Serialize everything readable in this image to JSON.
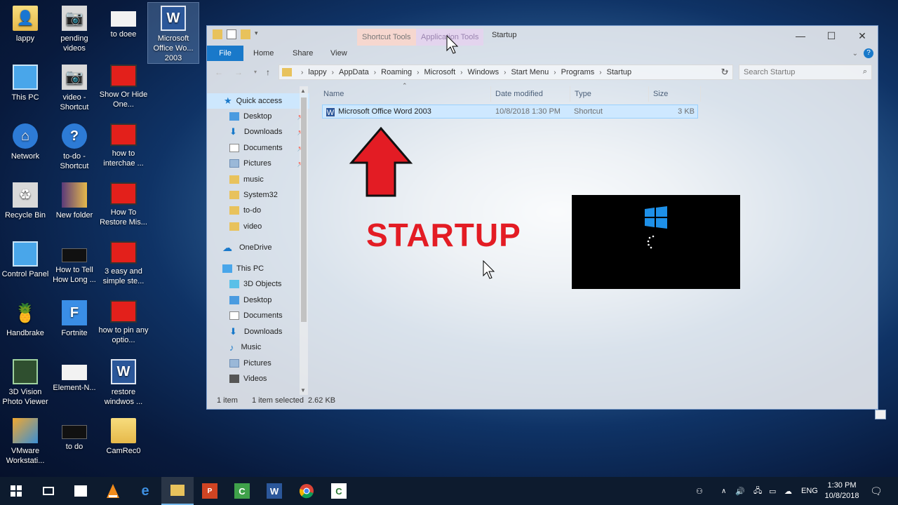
{
  "desktop": {
    "icons": [
      {
        "label": "lappy",
        "icon": "user-folder-icon"
      },
      {
        "label": "pending videos",
        "icon": "camera-icon"
      },
      {
        "label": "to doee",
        "icon": "white-file-icon"
      },
      {
        "label": "Microsoft Office Wo... 2003",
        "icon": "word-icon"
      },
      {
        "label": "This PC",
        "icon": "pc-icon"
      },
      {
        "label": "video - Shortcut",
        "icon": "camera-icon"
      },
      {
        "label": "Show Or Hide One...",
        "icon": "video-thumbnail-icon"
      },
      {
        "label": "Network",
        "icon": "network-icon"
      },
      {
        "label": "to-do - Shortcut",
        "icon": "help-icon"
      },
      {
        "label": "how to interchae ...",
        "icon": "video-thumbnail-icon"
      },
      {
        "label": "Recycle Bin",
        "icon": "recycle-bin-icon"
      },
      {
        "label": "New folder",
        "icon": "folder-icon"
      },
      {
        "label": "How To Restore Mis...",
        "icon": "video-thumbnail-icon"
      },
      {
        "label": "Control Panel",
        "icon": "control-panel-icon"
      },
      {
        "label": "How to Tell How Long ...",
        "icon": "video-thumbnail-icon"
      },
      {
        "label": "3 easy and simple ste...",
        "icon": "video-thumbnail-icon"
      },
      {
        "label": "Handbrake",
        "icon": "handbrake-icon"
      },
      {
        "label": "Fortnite",
        "icon": "fortnite-icon"
      },
      {
        "label": "how to pin any optio...",
        "icon": "video-thumbnail-icon"
      },
      {
        "label": "3D Vision Photo Viewer",
        "icon": "3d-vision-icon"
      },
      {
        "label": "Element-N...",
        "icon": "white-file-icon"
      },
      {
        "label": "restore windwos ...",
        "icon": "word-icon"
      },
      {
        "label": "VMware Workstati...",
        "icon": "vmware-icon"
      },
      {
        "label": "to do",
        "icon": "black-file-icon"
      },
      {
        "label": "CamRec0",
        "icon": "folder-icon"
      }
    ]
  },
  "window": {
    "ctx_shortcut": "Shortcut Tools",
    "ctx_app": "Application Tools",
    "title": "Startup",
    "minimize": "—",
    "maximize": "☐",
    "close": "✕",
    "tabs": {
      "file": "File",
      "home": "Home",
      "share": "Share",
      "view": "View"
    },
    "address": [
      "lappy",
      "AppData",
      "Roaming",
      "Microsoft",
      "Windows",
      "Start Menu",
      "Programs",
      "Startup"
    ],
    "search_placeholder": "Search Startup",
    "nav": {
      "quick_access": "Quick access",
      "qa_items": [
        "Desktop",
        "Downloads",
        "Documents",
        "Pictures",
        "music",
        "System32",
        "to-do",
        "video"
      ],
      "onedrive": "OneDrive",
      "this_pc": "This PC",
      "pc_items": [
        "3D Objects",
        "Desktop",
        "Documents",
        "Downloads",
        "Music",
        "Pictures",
        "Videos"
      ]
    },
    "columns": {
      "name": "Name",
      "date": "Date modified",
      "type": "Type",
      "size": "Size"
    },
    "files": [
      {
        "name": "Microsoft Office Word 2003",
        "date": "10/8/2018 1:30 PM",
        "type": "Shortcut",
        "size": "3 KB"
      }
    ],
    "status": {
      "count": "1 item",
      "selected": "1 item selected",
      "size": "2.62 KB"
    }
  },
  "overlay": {
    "startup_text": "STARTUP"
  },
  "taskbar": {
    "language": "ENG",
    "time": "1:30 PM",
    "date": "10/8/2018"
  },
  "colors": {
    "accent": "#1979ca",
    "arrow_red": "#e31c24",
    "taskbar": "#0d1b2e"
  }
}
